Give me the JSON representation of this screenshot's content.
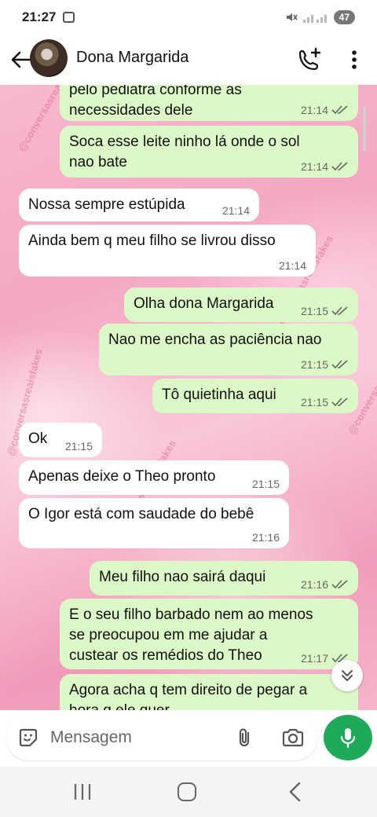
{
  "status_bar": {
    "time": "21:27",
    "battery": "47"
  },
  "header": {
    "contact_name": "Dona Margarida"
  },
  "messages": [
    {
      "dir": "out",
      "lines": [
        "pelo pediatra conforme as",
        "necessidades dele"
      ],
      "time": "21:14",
      "read": true
    },
    {
      "dir": "out",
      "lines": [
        "Soca esse leite ninho lá onde o sol",
        "nao bate"
      ],
      "time": "21:14",
      "read": true
    },
    {
      "dir": "in",
      "lines": [
        "Nossa sempre estúpida"
      ],
      "time": "21:14"
    },
    {
      "dir": "in",
      "lines": [
        "Ainda bem q meu filho se livrou disso"
      ],
      "time": "21:14"
    },
    {
      "dir": "out",
      "lines": [
        "Olha dona Margarida"
      ],
      "time": "21:15",
      "read": true
    },
    {
      "dir": "out",
      "lines": [
        "Nao me encha as paciência nao"
      ],
      "time": "21:15",
      "read": true
    },
    {
      "dir": "out",
      "lines": [
        "Tô quietinha aqui"
      ],
      "time": "21:15",
      "read": true
    },
    {
      "dir": "in",
      "lines": [
        "Ok"
      ],
      "time": "21:15"
    },
    {
      "dir": "in",
      "lines": [
        "Apenas deixe o Theo pronto"
      ],
      "time": "21:15"
    },
    {
      "dir": "in",
      "lines": [
        "O Igor está com saudade do bebê"
      ],
      "time": "21:16"
    },
    {
      "dir": "out",
      "lines": [
        "Meu filho nao sairá daqui"
      ],
      "time": "21:16",
      "read": true
    },
    {
      "dir": "out",
      "lines": [
        "E o seu filho barbado nem ao menos",
        "se preocupou em me ajudar a",
        "custear os remédios do Theo"
      ],
      "time": "21:17",
      "read": true
    },
    {
      "dir": "out",
      "lines": [
        "Agora acha q tem direito de pegar a",
        "hora q ele quer"
      ],
      "time": "",
      "read": false
    }
  ],
  "watermarks": [
    "@conversasreaisfakes",
    "conversasreaisfakes",
    "@conversasreaisfakes",
    "conversasreaisfakes",
    "@conversasreaisfakes"
  ],
  "composer": {
    "placeholder": "Mensagem"
  },
  "colors": {
    "outgoing_bubble": "#dcf8c6",
    "incoming_bubble": "#ffffff",
    "read_ticks": "#5b6b5f",
    "mic_button": "#1faa59"
  }
}
